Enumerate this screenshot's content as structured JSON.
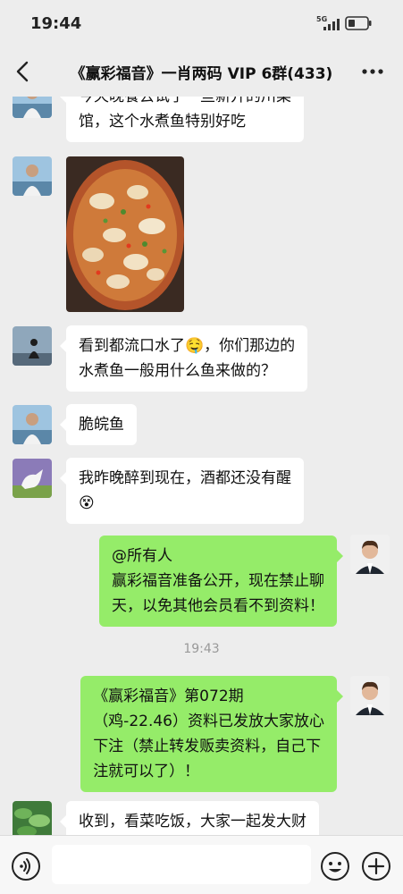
{
  "status_bar": {
    "time": "19:44",
    "network": "5G",
    "signal_icon": "signal-icon",
    "battery_icon": "battery-icon"
  },
  "header": {
    "title": "《赢彩福音》一肖两码 VIP 6群(433)",
    "back_icon": "back-arrow-icon",
    "more_icon": "more-icon"
  },
  "messages": [
    {
      "type": "text",
      "side": "left",
      "avatar": "avatar-man-lakeside",
      "lines": [
        "今天晚餐去试了一些新开的川菜",
        "馆，这个水煮鱼特别好吃"
      ]
    },
    {
      "type": "image",
      "side": "left",
      "avatar": "avatar-man-lakeside",
      "image": "boiled-fish-dish-photo"
    },
    {
      "type": "text",
      "side": "left",
      "avatar": "avatar-sitting-silhouette",
      "lines": [
        "看到都流口水了🤤，你们那边的",
        "水煮鱼一般用什么鱼来做的？"
      ]
    },
    {
      "type": "text",
      "side": "left",
      "avatar": "avatar-man-lakeside",
      "lines": [
        "脆皖鱼"
      ]
    },
    {
      "type": "text",
      "side": "left",
      "avatar": "avatar-white-horse",
      "lines": [
        "我昨晚醉到现在，酒都还没有醒",
        "😵"
      ]
    },
    {
      "type": "text",
      "side": "right",
      "avatar": "avatar-man-in-suit",
      "lines": [
        "@所有人",
        "赢彩福音准备公开，现在禁止聊",
        "天，以免其他会员看不到资料！"
      ]
    },
    {
      "type": "time",
      "text": "19:43"
    },
    {
      "type": "text",
      "side": "right",
      "avatar": "avatar-man-in-suit",
      "lines": [
        "《赢彩福音》第072期",
        "（鸡-22.46）资料已发放大家放心",
        "下注（禁止转发贩卖资料，自己下",
        "注就可以了）！"
      ]
    },
    {
      "type": "text",
      "side": "left",
      "avatar": "avatar-green-plants",
      "lines": [
        "收到，看菜吃饭，大家一起发大财"
      ]
    }
  ],
  "input_bar": {
    "voice_icon": "voice-icon",
    "text_value": "",
    "emoji_icon": "emoji-icon",
    "plus_icon": "plus-icon"
  },
  "colors": {
    "background": "#ededed",
    "bubble_incoming": "#ffffff",
    "bubble_outgoing": "#95ec69",
    "timestamp": "#999999"
  }
}
